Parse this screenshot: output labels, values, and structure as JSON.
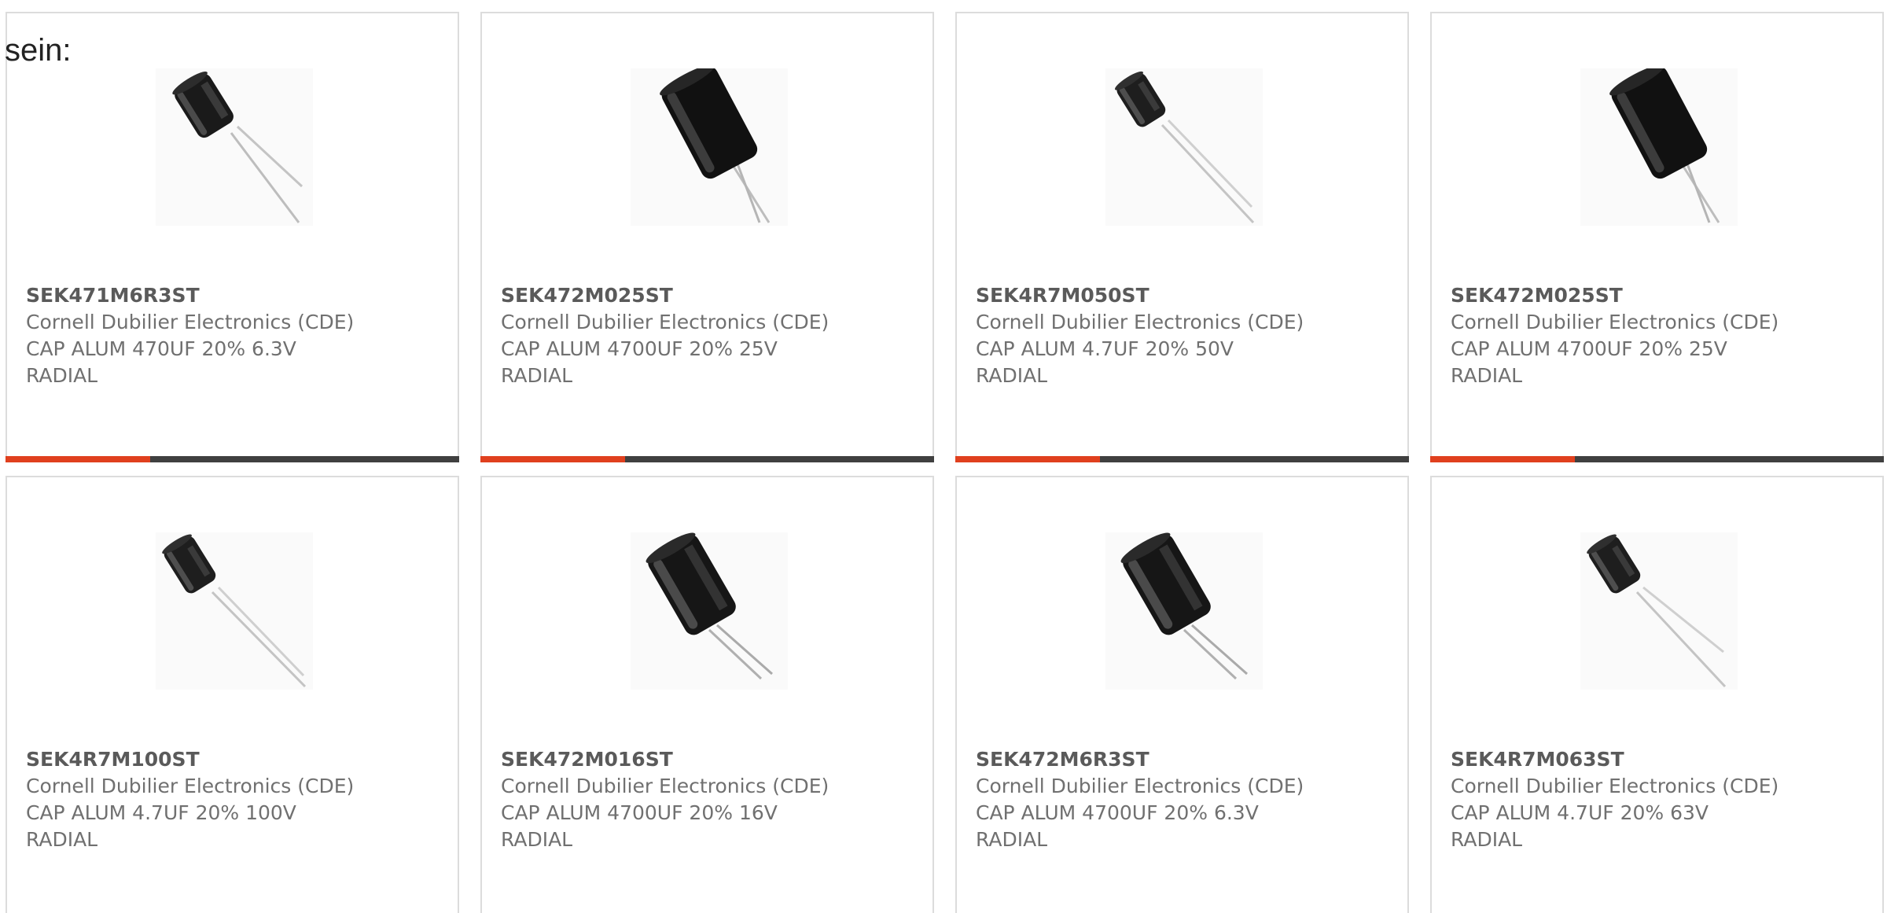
{
  "intro": {
    "text": "sein:"
  },
  "colors": {
    "accent": "#e0401e",
    "bar": "#404040",
    "border": "#dcdcdc",
    "text": "#707070"
  },
  "products": [
    {
      "part_number": "SEK471M6R3ST",
      "manufacturer": "Cornell Dubilier Electronics (CDE)",
      "description": "CAP ALUM 470UF 20% 6.3V",
      "package": "RADIAL",
      "image": "capacitor-small-icon"
    },
    {
      "part_number": "SEK472M025ST",
      "manufacturer": "Cornell Dubilier Electronics (CDE)",
      "description": "CAP ALUM 4700UF 20% 25V",
      "package": "RADIAL",
      "image": "capacitor-large-icon"
    },
    {
      "part_number": "SEK4R7M050ST",
      "manufacturer": "Cornell Dubilier Electronics (CDE)",
      "description": "CAP ALUM 4.7UF 20% 50V",
      "package": "RADIAL",
      "image": "capacitor-small-icon"
    },
    {
      "part_number": "SEK472M025ST",
      "manufacturer": "Cornell Dubilier Electronics (CDE)",
      "description": "CAP ALUM 4700UF 20% 25V",
      "package": "RADIAL",
      "image": "capacitor-large-icon"
    },
    {
      "part_number": "SEK4R7M100ST",
      "manufacturer": "Cornell Dubilier Electronics (CDE)",
      "description": "CAP ALUM 4.7UF 20% 100V",
      "package": "RADIAL",
      "image": "capacitor-small-icon"
    },
    {
      "part_number": "SEK472M016ST",
      "manufacturer": "Cornell Dubilier Electronics (CDE)",
      "description": "CAP ALUM 4700UF 20% 16V",
      "package": "RADIAL",
      "image": "capacitor-medium-icon"
    },
    {
      "part_number": "SEK472M6R3ST",
      "manufacturer": "Cornell Dubilier Electronics (CDE)",
      "description": "CAP ALUM 4700UF 20% 6.3V",
      "package": "RADIAL",
      "image": "capacitor-medium-icon"
    },
    {
      "part_number": "SEK4R7M063ST",
      "manufacturer": "Cornell Dubilier Electronics (CDE)",
      "description": "CAP ALUM 4.7UF 20% 63V",
      "package": "RADIAL",
      "image": "capacitor-small-icon"
    }
  ]
}
